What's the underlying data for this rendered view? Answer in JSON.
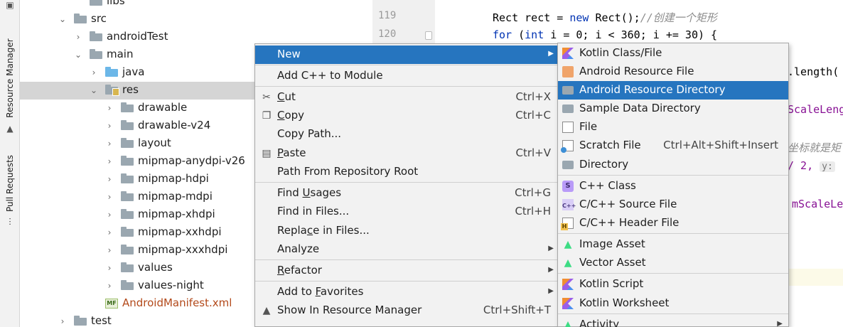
{
  "sidebar": {
    "resource_manager": "Resource Manager",
    "pull_requests": "Pull Requests"
  },
  "tree": {
    "items": [
      {
        "label": "libs",
        "kind": "folder"
      },
      {
        "label": "src",
        "kind": "folder"
      },
      {
        "label": "androidTest",
        "kind": "folder"
      },
      {
        "label": "main",
        "kind": "folder"
      },
      {
        "label": "java",
        "kind": "folder-blue"
      },
      {
        "label": "res",
        "kind": "folder-res"
      },
      {
        "label": "drawable",
        "kind": "folder"
      },
      {
        "label": "drawable-v24",
        "kind": "folder"
      },
      {
        "label": "layout",
        "kind": "folder"
      },
      {
        "label": "mipmap-anydpi-v26",
        "kind": "folder"
      },
      {
        "label": "mipmap-hdpi",
        "kind": "folder"
      },
      {
        "label": "mipmap-mdpi",
        "kind": "folder"
      },
      {
        "label": "mipmap-xhdpi",
        "kind": "folder"
      },
      {
        "label": "mipmap-xxhdpi",
        "kind": "folder"
      },
      {
        "label": "mipmap-xxxhdpi",
        "kind": "folder"
      },
      {
        "label": "values",
        "kind": "folder"
      },
      {
        "label": "values-night",
        "kind": "folder"
      },
      {
        "label": "AndroidManifest.xml",
        "kind": "manifest"
      },
      {
        "label": "test",
        "kind": "folder"
      }
    ],
    "manifest_icon_text": "MF"
  },
  "editor": {
    "line_numbers": [
      "119",
      "120"
    ],
    "line119": {
      "a": "Rect rect = ",
      "kw": "new",
      "b": " Rect();",
      "comment": "//创建一个矩形"
    },
    "line120": {
      "kw1": "for",
      "a": " (",
      "kw2": "int",
      "b": " i = 0; i < 360; i += 30) {"
    },
    "frag_length": ".length(",
    "frag_scale": "ScaleLeng",
    "frag_comment": "坐标就是矩",
    "frag_div": "/ 2,",
    "frag_hint": "y:",
    "frag_scale2": "mScaleLe"
  },
  "menu": {
    "items": [
      {
        "label": "New",
        "shortcut": "",
        "submenu": true,
        "icon": "",
        "active": true
      },
      {
        "label": "Add C++ to Module",
        "shortcut": "",
        "submenu": false,
        "icon": ""
      },
      {
        "label": "Cut",
        "shortcut": "Ctrl+X",
        "submenu": false,
        "icon": "scissors-icon"
      },
      {
        "label": "Copy",
        "shortcut": "Ctrl+C",
        "submenu": false,
        "icon": "copy-icon"
      },
      {
        "label": "Copy Path...",
        "shortcut": "",
        "submenu": false,
        "icon": ""
      },
      {
        "label": "Paste",
        "shortcut": "Ctrl+V",
        "submenu": false,
        "icon": "clipboard-icon"
      },
      {
        "label": "Path From Repository Root",
        "shortcut": "",
        "submenu": false,
        "icon": ""
      },
      {
        "label": "Find Usages",
        "shortcut": "Ctrl+G",
        "submenu": false,
        "icon": ""
      },
      {
        "label": "Find in Files...",
        "shortcut": "Ctrl+H",
        "submenu": false,
        "icon": ""
      },
      {
        "label": "Replace in Files...",
        "shortcut": "",
        "submenu": false,
        "icon": ""
      },
      {
        "label": "Analyze",
        "shortcut": "",
        "submenu": true,
        "icon": ""
      },
      {
        "label": "Refactor",
        "shortcut": "",
        "submenu": true,
        "icon": ""
      },
      {
        "label": "Add to Favorites",
        "shortcut": "",
        "submenu": true,
        "icon": ""
      },
      {
        "label": "Show In Resource Manager",
        "shortcut": "Ctrl+Shift+T",
        "submenu": false,
        "icon": "resource-manager-icon"
      }
    ]
  },
  "submenu": {
    "items": [
      {
        "label": "Kotlin Class/File",
        "shortcut": "",
        "icon": "kotlin-icon"
      },
      {
        "label": "Android Resource File",
        "shortcut": "",
        "icon": "android-resource-file-icon"
      },
      {
        "label": "Android Resource Directory",
        "shortcut": "",
        "icon": "folder-icon",
        "active": true
      },
      {
        "label": "Sample Data Directory",
        "shortcut": "",
        "icon": "folder-icon"
      },
      {
        "label": "File",
        "shortcut": "",
        "icon": "file-icon"
      },
      {
        "label": "Scratch File",
        "shortcut": "Ctrl+Alt+Shift+Insert",
        "icon": "scratch-file-icon"
      },
      {
        "label": "Directory",
        "shortcut": "",
        "icon": "folder-icon"
      },
      {
        "label": "C++ Class",
        "shortcut": "",
        "icon": "cpp-class-icon",
        "icon_text": "S"
      },
      {
        "label": "C/C++ Source File",
        "shortcut": "",
        "icon": "cpp-source-icon",
        "icon_text": "C++"
      },
      {
        "label": "C/C++ Header File",
        "shortcut": "",
        "icon": "cpp-header-icon"
      },
      {
        "label": "Image Asset",
        "shortcut": "",
        "icon": "android-icon"
      },
      {
        "label": "Vector Asset",
        "shortcut": "",
        "icon": "android-icon"
      },
      {
        "label": "Kotlin Script",
        "shortcut": "",
        "icon": "kotlin-script-icon"
      },
      {
        "label": "Kotlin Worksheet",
        "shortcut": "",
        "icon": "kotlin-worksheet-icon"
      },
      {
        "label": "Activity",
        "shortcut": "",
        "icon": "android-icon",
        "submenu": true
      }
    ]
  },
  "colors": {
    "accent": "#2675bf",
    "keyword": "#0033b3",
    "comment": "#8c8c8c",
    "field": "#871094",
    "manifest": "#b34a1b"
  }
}
